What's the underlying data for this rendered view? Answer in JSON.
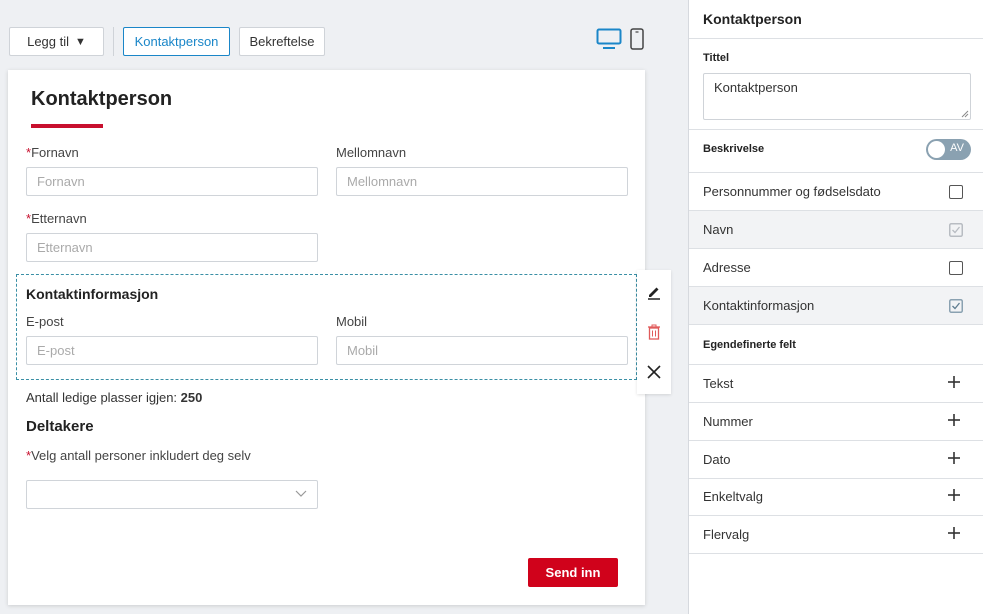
{
  "toolbar": {
    "add_label": "Legg til",
    "tab_contact": "Kontaktperson",
    "tab_confirm": "Bekreftelse",
    "accent": "#1a86c8"
  },
  "form": {
    "title": "Kontaktperson",
    "required_mark": "*",
    "fields": {
      "firstname_label": "Fornavn",
      "firstname_placeholder": "Fornavn",
      "middlename_label": "Mellomnavn",
      "middlename_placeholder": "Mellomnavn",
      "lastname_label": "Etternavn",
      "lastname_placeholder": "Etternavn"
    },
    "contact_group": {
      "title": "Kontaktinformasjon",
      "email_label": "E-post",
      "email_placeholder": "E-post",
      "mobile_label": "Mobil",
      "mobile_placeholder": "Mobil"
    },
    "seats_label": "Antall ledige plasser igjen:",
    "seats_value": "250",
    "participants_title": "Deltakere",
    "participants_select_label": "Velg antall personer inkludert deg selv",
    "submit_label": "Send inn",
    "brand_color": "#c8102e"
  },
  "panel": {
    "title": "Kontaktperson",
    "title_field_label": "Tittel",
    "title_field_value": "Kontaktperson",
    "description_label": "Beskrivelse",
    "description_toggle": "AV",
    "options": [
      {
        "label": "Personnummer og fødselsdato",
        "checked": false
      },
      {
        "label": "Navn",
        "checked": true
      },
      {
        "label": "Adresse",
        "checked": false
      },
      {
        "label": "Kontaktinformasjon",
        "checked": true
      }
    ],
    "custom_fields_label": "Egendefinerte felt",
    "custom_fields": [
      "Tekst",
      "Nummer",
      "Dato",
      "Enkeltvalg",
      "Flervalg"
    ]
  }
}
